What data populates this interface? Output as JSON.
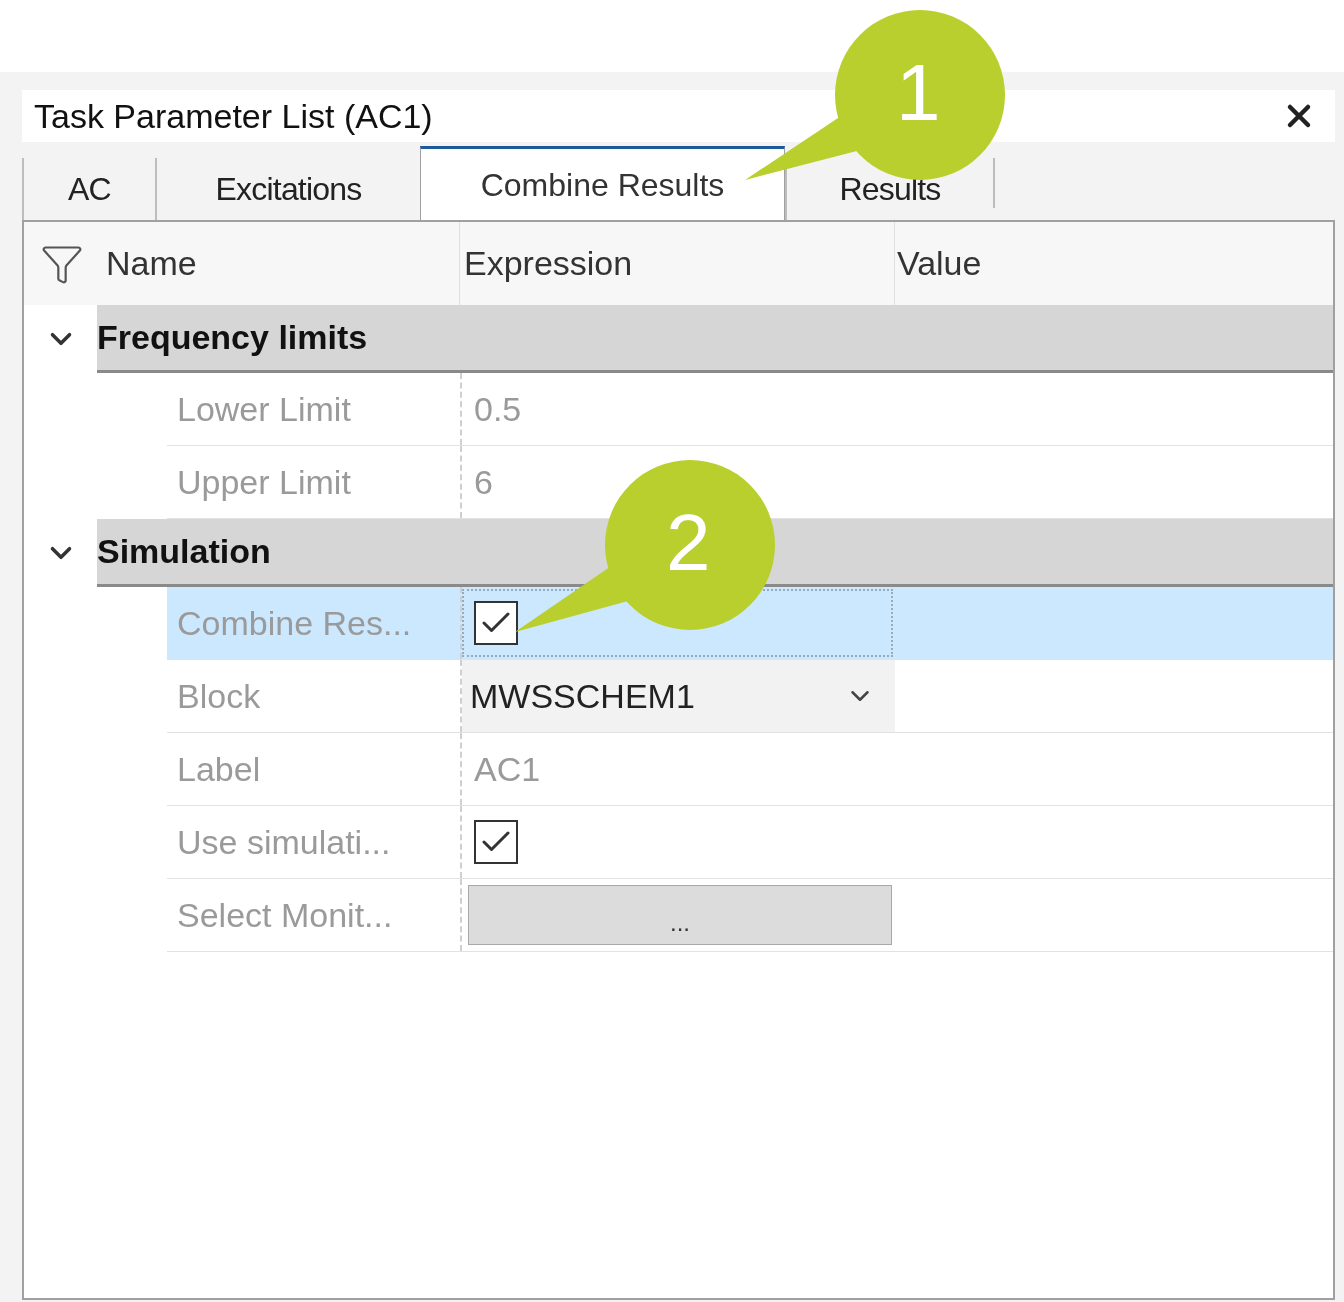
{
  "panel": {
    "title": "Task Parameter List (AC1)"
  },
  "tabs": [
    {
      "label": "AC",
      "selected": false
    },
    {
      "label": "Excitations",
      "selected": false
    },
    {
      "label": "Combine Results",
      "selected": true
    },
    {
      "label": "Results",
      "selected": false
    }
  ],
  "grid": {
    "columns": [
      "Name",
      "Expression",
      "Value"
    ],
    "categories": [
      {
        "title": "Frequency limits",
        "expanded": true,
        "rows": [
          {
            "name": "Lower Limit",
            "kind": "text",
            "value": "0.5",
            "selected": false
          },
          {
            "name": "Upper Limit",
            "kind": "text",
            "value": "6",
            "selected": false
          }
        ]
      },
      {
        "title": "Simulation",
        "expanded": true,
        "rows": [
          {
            "name": "Combine Res...",
            "kind": "checkbox",
            "checked": true,
            "selected": true
          },
          {
            "name": "Block",
            "kind": "dropdown",
            "value": "MWSSCHEM1",
            "selected": false
          },
          {
            "name": "Label",
            "kind": "text",
            "value": "AC1",
            "selected": false
          },
          {
            "name": "Use simulati...",
            "kind": "checkbox",
            "checked": true,
            "selected": false
          },
          {
            "name": "Select Monit...",
            "kind": "button",
            "label": "...",
            "selected": false
          }
        ]
      }
    ]
  },
  "callouts": [
    {
      "number": "1"
    },
    {
      "number": "2"
    }
  ]
}
